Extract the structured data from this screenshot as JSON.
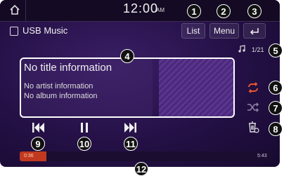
{
  "statusbar": {
    "time": "12:00",
    "ampm": "AM"
  },
  "source": {
    "label": "USB Music"
  },
  "buttons": {
    "list": "List",
    "menu": "Menu"
  },
  "track_counter": "1/21",
  "track": {
    "title": "No title information",
    "artist": "No artist information",
    "album": "No album information"
  },
  "progress": {
    "elapsed": "0:36",
    "total": "5:43",
    "fraction": 0.105
  },
  "callouts": [
    "1",
    "2",
    "3",
    "4",
    "5",
    "6",
    "7",
    "8",
    "9",
    "10",
    "11",
    "12"
  ],
  "colors": {
    "accent": "#e8562d",
    "progress": "#c0391f",
    "background": "#241045"
  }
}
